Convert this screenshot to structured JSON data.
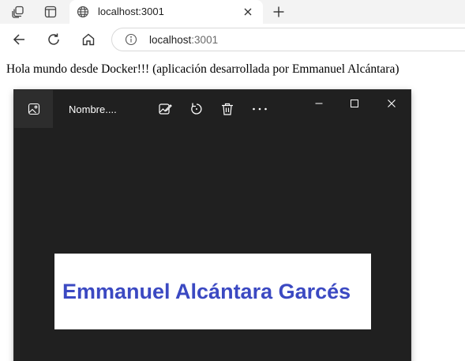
{
  "browser": {
    "tab": {
      "title": "localhost:3001"
    },
    "address_bar": {
      "host": "localhost",
      "port": ":3001"
    },
    "icons": {
      "workspaces": "workspaces-icon",
      "tab_actions": "tab-actions-icon",
      "favicon": "globe-icon",
      "tab_close": "close-icon",
      "new_tab": "plus-icon",
      "back": "back-arrow-icon",
      "reload": "reload-icon",
      "home": "home-icon",
      "site_info": "info-icon"
    }
  },
  "page": {
    "message": "Hola mundo desde Docker!!! (aplicación desarrollada por Emmanuel Alcántara)"
  },
  "photos_viewer": {
    "filename": "Nombre....",
    "image_text": "Emmanuel Alcántara Garcés",
    "image_text_color": "#3b49c2",
    "background_color": "#202020",
    "icons": {
      "app": "photo-icon",
      "edit": "edit-image-icon",
      "rotate": "rotate-icon",
      "delete": "trash-icon",
      "more": "more-icon",
      "minimize": "minimize-icon",
      "maximize": "maximize-icon",
      "close": "close-icon"
    }
  }
}
